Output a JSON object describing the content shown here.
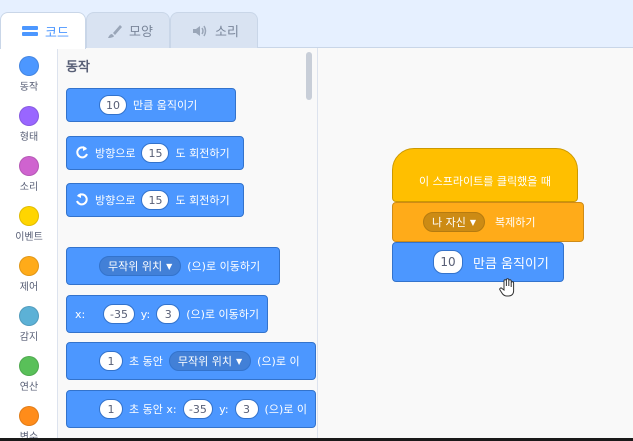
{
  "tabs": [
    {
      "label": "코드",
      "icon": "code-icon",
      "active": true
    },
    {
      "label": "모양",
      "icon": "brush-icon",
      "active": false
    },
    {
      "label": "소리",
      "icon": "speaker-icon",
      "active": false
    }
  ],
  "categories": [
    {
      "label": "동작",
      "color": "#4c97ff"
    },
    {
      "label": "형태",
      "color": "#9966ff"
    },
    {
      "label": "소리",
      "color": "#cf63cf"
    },
    {
      "label": "이벤트",
      "color": "#ffd500"
    },
    {
      "label": "제어",
      "color": "#ffab19"
    },
    {
      "label": "감지",
      "color": "#5cb1d6"
    },
    {
      "label": "연산",
      "color": "#59c059"
    },
    {
      "label": "변수",
      "color": "#ff8c1a"
    }
  ],
  "palette": {
    "title": "동작",
    "move": {
      "value": "10",
      "text": "만큼 움직이기"
    },
    "turn_right": {
      "prefix": "방향으로",
      "value": "15",
      "suffix": "도 회전하기"
    },
    "turn_left": {
      "prefix": "방향으로",
      "value": "15",
      "suffix": "도 회전하기"
    },
    "goto": {
      "dropdown": "무작위 위치",
      "suffix": "(으)로 이동하기"
    },
    "goto_xy": {
      "x_label": "x:",
      "x": "-35",
      "y_label": "y:",
      "y": "3",
      "suffix": "(으)로 이동하기"
    },
    "glide": {
      "secs": "1",
      "text": "초 동안",
      "dropdown": "무작위 위치",
      "suffix": "(으)로 이"
    },
    "glide_xy": {
      "secs": "1",
      "text": "초 동안 x:",
      "x": "-35",
      "y_label": "y:",
      "y": "3",
      "suffix": "(으)로 이"
    }
  },
  "script": {
    "hat": "이 스프라이트를 클릭했을 때",
    "clone": {
      "dropdown": "나 자신",
      "text": "복제하기"
    },
    "move": {
      "value": "10",
      "text": "만큼 움직이기"
    }
  }
}
